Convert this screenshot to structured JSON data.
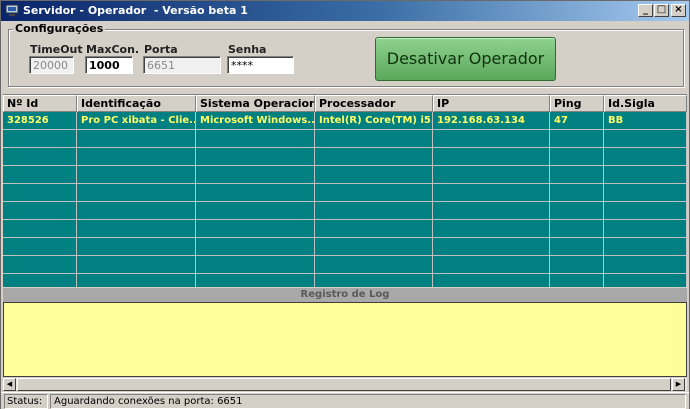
{
  "window": {
    "title": "Servidor - Operador  - Versão beta 1",
    "minimize": "_",
    "maximize": "□",
    "close": "×"
  },
  "config": {
    "group_title": "Configurações",
    "fields": [
      {
        "label": "TimeOut",
        "value": "20000",
        "state": "disabled"
      },
      {
        "label": "MaxCon.",
        "value": "1000",
        "state": "enabled"
      },
      {
        "label": "Porta",
        "value": "6651",
        "state": "disabled"
      },
      {
        "label": "Senha",
        "value": "****",
        "state": "enabled"
      }
    ],
    "action_button": "Desativar Operador"
  },
  "grid": {
    "columns": [
      "Nº Id",
      "Identificação",
      "Sistema Operacional",
      "Processador",
      "IP",
      "Ping",
      "Id.Sigla"
    ],
    "rows": [
      [
        "328526",
        "Pro PC xibata - Clie...",
        "Microsoft Windows...",
        "Intel(R) Core(TM) i5...",
        "192.168.63.134",
        "47",
        "BB"
      ],
      [
        "",
        "",
        "",
        "",
        "",
        "",
        ""
      ],
      [
        "",
        "",
        "",
        "",
        "",
        "",
        ""
      ],
      [
        "",
        "",
        "",
        "",
        "",
        "",
        ""
      ],
      [
        "",
        "",
        "",
        "",
        "",
        "",
        ""
      ],
      [
        "",
        "",
        "",
        "",
        "",
        "",
        ""
      ],
      [
        "",
        "",
        "",
        "",
        "",
        "",
        ""
      ],
      [
        "",
        "",
        "",
        "",
        "",
        "",
        ""
      ],
      [
        "",
        "",
        "",
        "",
        "",
        "",
        ""
      ],
      [
        "",
        "",
        "",
        "",
        "",
        "",
        ""
      ]
    ]
  },
  "log": {
    "title": "Registro de Log",
    "content": ""
  },
  "statusbar": {
    "label": "Status:",
    "text": "Aguardando conexões na porta: 6651"
  },
  "colors": {
    "grid_background": "#008080",
    "grid_text": "#ffff66",
    "log_background": "#ffff99",
    "button_green": "#5aa85a"
  }
}
